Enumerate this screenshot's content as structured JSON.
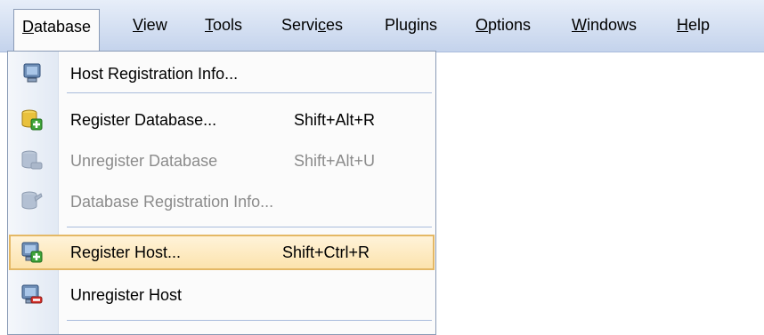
{
  "menubar": {
    "items": [
      {
        "label": "Database",
        "mnemonic": "D"
      },
      {
        "label": "View",
        "mnemonic": "V"
      },
      {
        "label": "Tools",
        "mnemonic": "T"
      },
      {
        "label": "Services",
        "mnemonic": "c"
      },
      {
        "label": "Plugins",
        "mnemonic": ""
      },
      {
        "label": "Options",
        "mnemonic": "O"
      },
      {
        "label": "Windows",
        "mnemonic": "W"
      },
      {
        "label": "Help",
        "mnemonic": "H"
      }
    ]
  },
  "database_menu": {
    "items": [
      {
        "label": "Host Registration Info...",
        "shortcut": "",
        "icon": "host-info-icon",
        "enabled": true
      },
      {
        "label": "Register Database...",
        "shortcut": "Shift+Alt+R",
        "icon": "register-database-icon",
        "enabled": true
      },
      {
        "label": "Unregister Database",
        "shortcut": "Shift+Alt+U",
        "icon": "unregister-database-icon",
        "enabled": false
      },
      {
        "label": "Database Registration Info...",
        "shortcut": "",
        "icon": "database-info-icon",
        "enabled": false
      },
      {
        "label": "Register Host...",
        "shortcut": "Shift+Ctrl+R",
        "icon": "register-host-icon",
        "enabled": true,
        "highlighted": true
      },
      {
        "label": "Unregister Host",
        "shortcut": "",
        "icon": "unregister-host-icon",
        "enabled": true
      }
    ]
  },
  "colors": {
    "menubar": "#c4d3ec",
    "highlight": "#fce3ad",
    "highlight_border": "#e4b865",
    "disabled_text": "#8b8b8b"
  }
}
